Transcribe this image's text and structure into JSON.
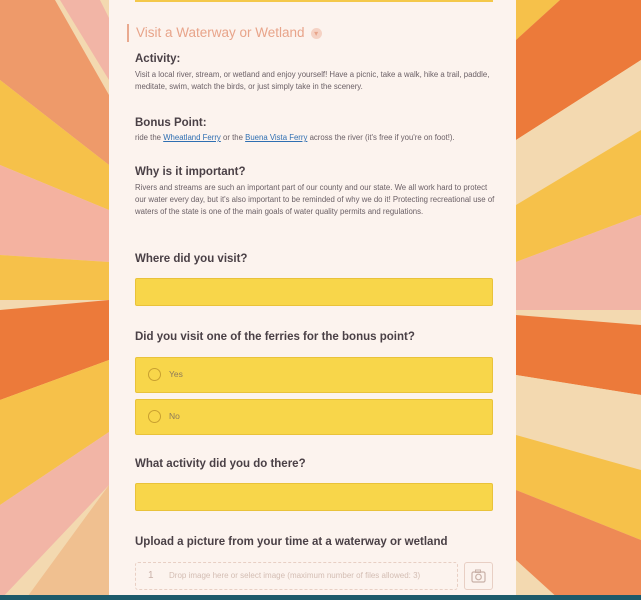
{
  "section": {
    "title": "Visit a Waterway or Wetland"
  },
  "activity": {
    "heading": "Activity:",
    "text": "Visit a local river, stream, or wetland and enjoy yourself! Have a picnic, take a walk, hike a trail, paddle, meditate, swim, watch the birds, or just simply take in the scenery."
  },
  "bonus": {
    "heading": "Bonus Point:",
    "text_before": "ride the",
    "link1": "Wheatland Ferry",
    "text_middle": "or the",
    "link2": "Buena Vista Ferry",
    "text_after": "across the river (it's free if you're on foot!)."
  },
  "why": {
    "heading": "Why is it important?",
    "text": "Rivers and streams are such an important part of our county and our state. We all work hard to protect our water every day, but it's also important to be reminded of why we do it! Protecting recreational use of waters of the state is one of the main goals of water quality permits and regulations."
  },
  "q1": {
    "label": "Where did you visit?",
    "value": ""
  },
  "q2": {
    "label": "Did you visit one of the ferries for the bonus point?",
    "options": [
      "Yes",
      "No"
    ]
  },
  "q3": {
    "label": "What activity did you do there?",
    "value": ""
  },
  "q4": {
    "label": "Upload a picture from your time at a waterway or wetland",
    "count": "1",
    "hint": "Drop image here or select image (maximum number of files allowed: 3)"
  },
  "colors": {
    "field": "#f8d64a",
    "card": "#fcf3ee",
    "accent": "#e8a48a",
    "link": "#2f6fb2",
    "bottom_bar": "#1d5a6a"
  },
  "icons": [
    "chevron-down-icon",
    "camera-icon"
  ]
}
